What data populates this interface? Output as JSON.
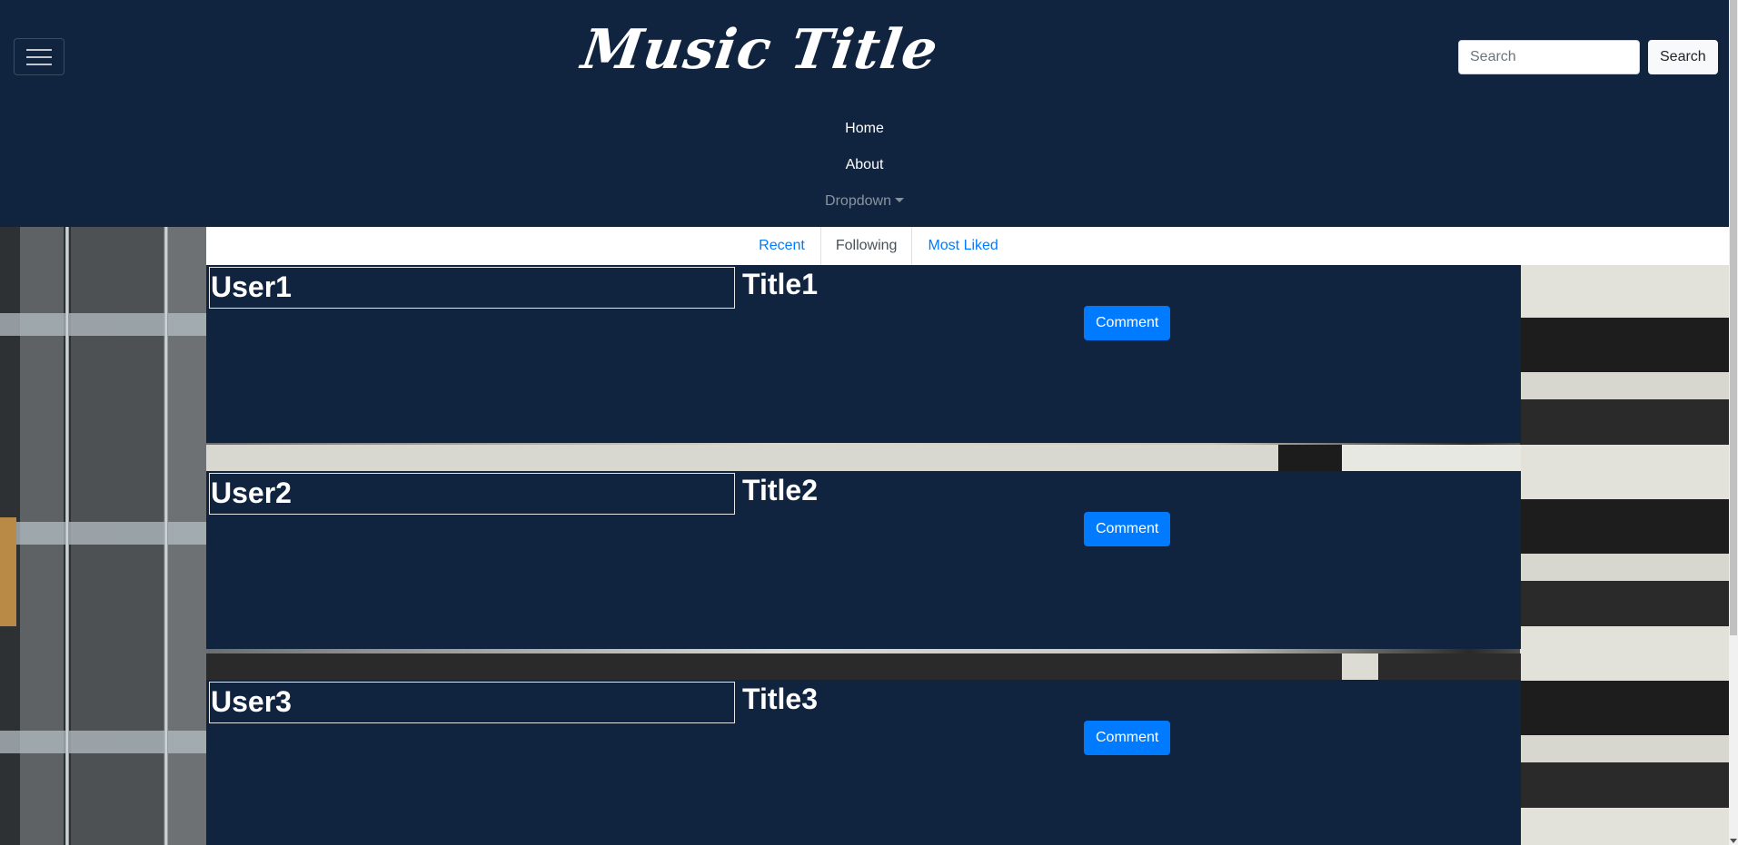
{
  "header": {
    "brand": "Music Title",
    "search": {
      "placeholder": "Search",
      "button_label": "Search"
    },
    "nav": {
      "home": "Home",
      "about": "About",
      "dropdown": "Dropdown"
    }
  },
  "tabs": [
    "Recent",
    "Following",
    "Most Liked"
  ],
  "active_tab": "Following",
  "posts": [
    {
      "user": "User1",
      "title": "Title1",
      "comment_label": "Comment"
    },
    {
      "user": "User2",
      "title": "Title2",
      "comment_label": "Comment"
    },
    {
      "user": "User3",
      "title": "Title3",
      "comment_label": "Comment"
    }
  ],
  "colors": {
    "navy": "#10243f",
    "primary": "#007bff",
    "tab_active_text": "#495057"
  }
}
